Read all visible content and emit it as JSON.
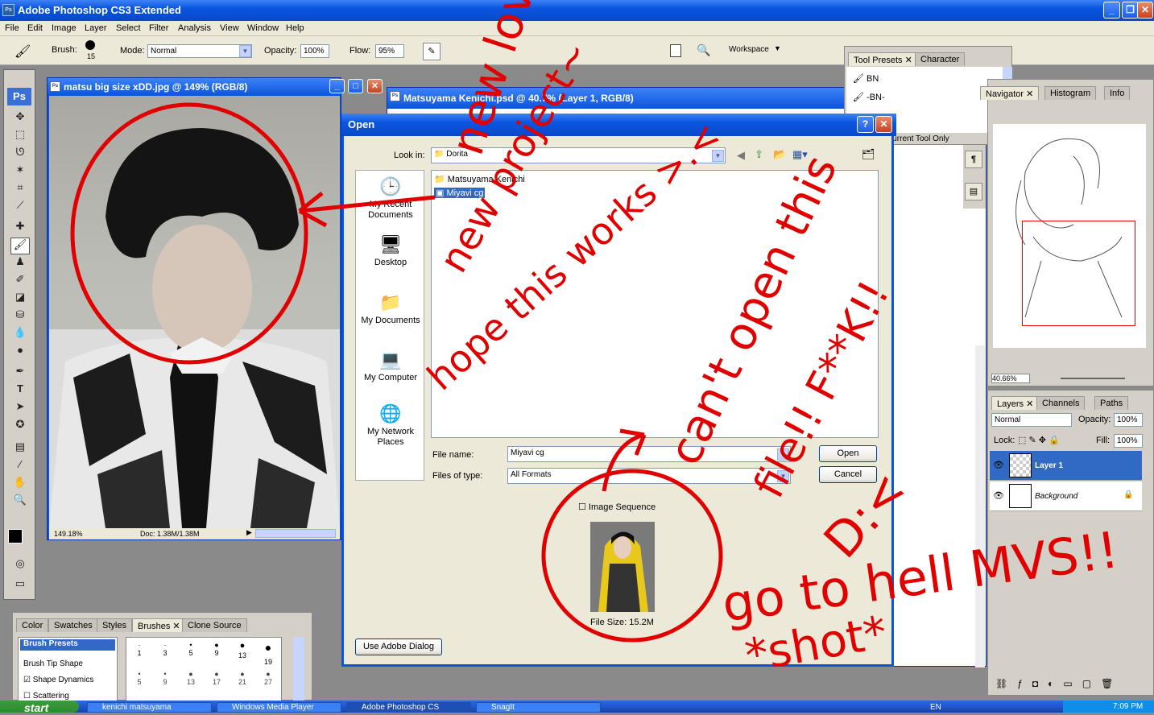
{
  "app": {
    "title": "Adobe Photoshop CS3 Extended"
  },
  "menu": [
    "File",
    "Edit",
    "Image",
    "Layer",
    "Select",
    "Filter",
    "Analysis",
    "View",
    "Window",
    "Help"
  ],
  "options": {
    "brush_label": "Brush:",
    "brush_size": "15",
    "mode_label": "Mode:",
    "mode_value": "Normal",
    "opacity_label": "Opacity:",
    "opacity_value": "100%",
    "flow_label": "Flow:",
    "flow_value": "95%",
    "workspace": "Workspace"
  },
  "doc1": {
    "title": "matsu big size xDD.jpg @ 149% (RGB/8)",
    "zoom": "149.18%",
    "docinfo": "Doc: 1.38M/1.38M"
  },
  "doc2": {
    "title": "Matsuyama Kenichi.psd @ 40.7% (Layer 1, RGB/8)"
  },
  "tool_presets": {
    "tabs": [
      "Tool Presets",
      "Character"
    ],
    "items": [
      "BN",
      "-BN-"
    ],
    "footer": "Current Tool Only"
  },
  "navigator": {
    "tabs": [
      "Navigator",
      "Histogram",
      "Info"
    ],
    "zoom": "40.66%"
  },
  "layers": {
    "tabs": [
      "Layers",
      "Channels",
      "Paths"
    ],
    "blend": "Normal",
    "opacity_label": "Opacity:",
    "opacity_value": "100%",
    "lock_label": "Lock:",
    "fill_label": "Fill:",
    "fill_value": "100%",
    "items": [
      "Layer 1",
      "Background"
    ]
  },
  "brushes": {
    "tabs": [
      "Color",
      "Swatches",
      "Styles",
      "Brushes",
      "Clone Source"
    ],
    "list": [
      "Brush Presets",
      "Brush Tip Shape",
      "Shape Dynamics",
      "Scattering"
    ],
    "sizes_row1": [
      "1",
      "3",
      "5",
      "9",
      "13",
      "19"
    ],
    "sizes_row2": [
      "5",
      "9",
      "13",
      "17",
      "21",
      "27"
    ]
  },
  "open_dialog": {
    "title": "Open",
    "look_in_label": "Look in:",
    "look_in_value": "Dorita",
    "places": [
      "My Recent Documents",
      "Desktop",
      "My Documents",
      "My Computer",
      "My Network Places"
    ],
    "files": [
      "Matsuyama Kenichi",
      "Miyavi cg"
    ],
    "file_name_label": "File name:",
    "file_name_value": "Miyavi cg",
    "file_type_label": "Files of type:",
    "file_type_value": "All Formats",
    "open_btn": "Open",
    "cancel_btn": "Cancel",
    "image_sequence": "Image Sequence",
    "file_size": "File Size: 15.2M",
    "use_adobe": "Use Adobe Dialog"
  },
  "taskbar": {
    "start": "start",
    "items": [
      "kenichi matsuyama",
      "Windows Media Player",
      "Adobe Photoshop CS",
      "SnagIt"
    ],
    "lang": "EN",
    "clock": "7:09 PM"
  },
  "annotations": {
    "a1": "new love",
    "a2": "new project~",
    "a3": "hope this works >.<",
    "a4": "can't open this",
    "a5": "file!! F**K!!",
    "a6": "D:<",
    "a7": "go to hell MVS!!",
    "a8": "*shot*"
  },
  "colors": {
    "accent": "#0a55e0",
    "ink": "#e00000"
  }
}
